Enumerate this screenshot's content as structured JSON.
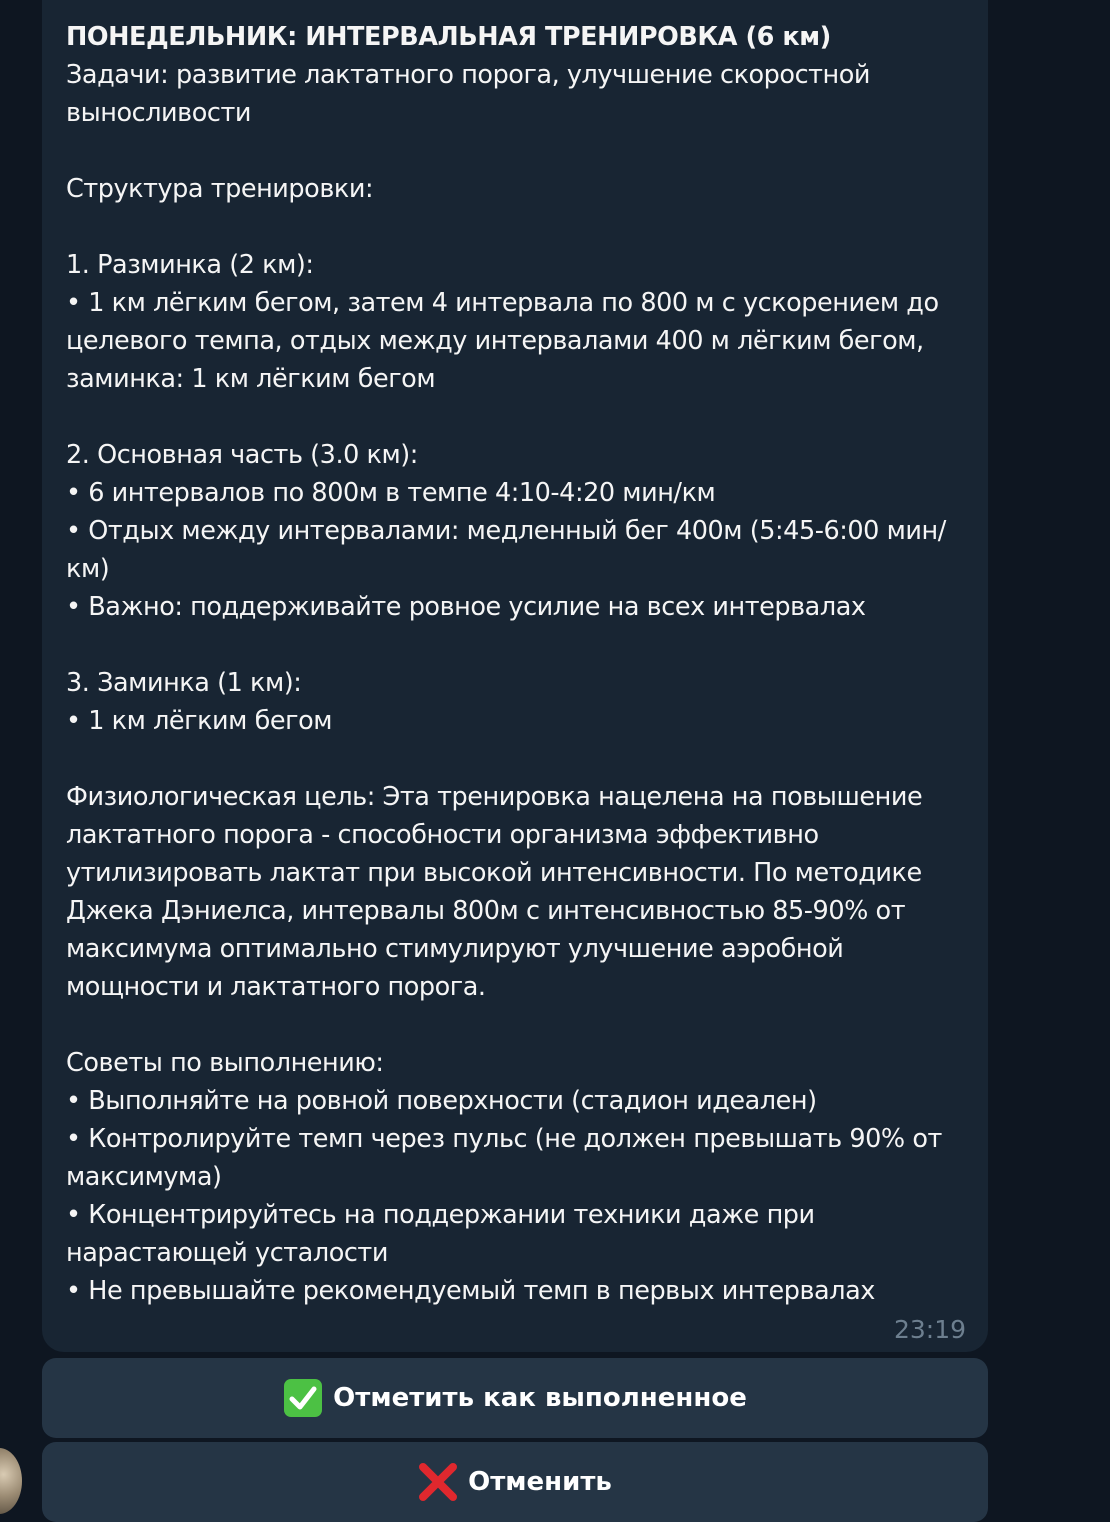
{
  "message": {
    "title": "ПОНЕДЕЛЬНИК: ИНТЕРВАЛЬНАЯ ТРЕНИРОВКА (6 км)",
    "body": "Задачи: развитие лактатного порога, улучшение скоростной выносливости\n\nСтруктура тренировки:\n\n1. Разминка (2 км):\n• 1 км лёгким бегом, затем 4 интервала по 800 м с ускорением до целевого темпа, отдых между интервалами 400 м лёгким бегом, заминка: 1 км лёгким бегом\n\n2. Основная часть (3.0 км):\n• 6 интервалов по 800м в темпе 4:10-4:20 мин/км\n• Отдых между интервалами: медленный бег 400м (5:45-6:00 мин/км)\n• Важно: поддерживайте ровное усилие на всех интервалах\n\n3. Заминка (1 км):\n• 1 км лёгким бегом\n\nФизиологическая цель: Эта тренировка нацелена на повышение лактатного порога - способности организма эффективно утилизировать лактат при высокой интенсивности. По методике Джека Дэниелса, интервалы 800м с интенсивностью 85-90% от максимума оптимально стимулируют улучшение аэробной мощности и лактатного порога.\n\nСоветы по выполнению:\n• Выполняйте на ровной поверхности (стадион идеален)\n• Контролируйте темп через пульс (не должен превышать 90% от максимума)\n• Концентрируйтесь на поддержании техники даже при нарастающей усталости\n• Не превышайте рекомендуемый темп в первых интервалах",
    "time": "23:19"
  },
  "buttons": {
    "done": {
      "icon": "check-mark-button-icon",
      "label": "Отметить как выполненное"
    },
    "cancel": {
      "icon": "cross-mark-icon",
      "label": "Отменить"
    }
  },
  "colors": {
    "background": "#0e1621",
    "bubble": "#182533",
    "button": "#253545",
    "check_green": "#4cc144",
    "cross_red": "#e0282e",
    "time": "#6d7f8f"
  }
}
